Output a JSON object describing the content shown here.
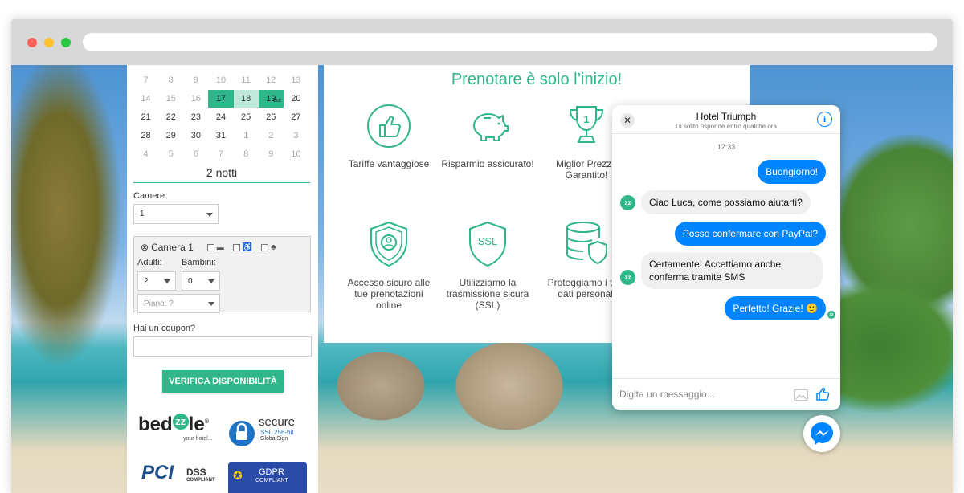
{
  "calendar": {
    "rows": [
      [
        {
          "d": "7",
          "s": "dim"
        },
        {
          "d": "8",
          "s": "dim"
        },
        {
          "d": "9",
          "s": "dim"
        },
        {
          "d": "10",
          "s": "dim"
        },
        {
          "d": "11",
          "s": "dim"
        },
        {
          "d": "12",
          "s": "dim"
        },
        {
          "d": "13",
          "s": "dim"
        }
      ],
      [
        {
          "d": "14",
          "s": "dim"
        },
        {
          "d": "15",
          "s": "dim"
        },
        {
          "d": "16",
          "s": "dim"
        },
        {
          "d": "17",
          "s": "sel"
        },
        {
          "d": "18",
          "s": "mid"
        },
        {
          "d": "19",
          "s": "out"
        },
        {
          "d": "20",
          "s": ""
        }
      ],
      [
        {
          "d": "21",
          "s": ""
        },
        {
          "d": "22",
          "s": ""
        },
        {
          "d": "23",
          "s": ""
        },
        {
          "d": "24",
          "s": ""
        },
        {
          "d": "25",
          "s": ""
        },
        {
          "d": "26",
          "s": ""
        },
        {
          "d": "27",
          "s": ""
        }
      ],
      [
        {
          "d": "28",
          "s": ""
        },
        {
          "d": "29",
          "s": ""
        },
        {
          "d": "30",
          "s": ""
        },
        {
          "d": "31",
          "s": ""
        },
        {
          "d": "1",
          "s": "dim"
        },
        {
          "d": "2",
          "s": "dim"
        },
        {
          "d": "3",
          "s": "dim"
        }
      ],
      [
        {
          "d": "4",
          "s": "dim"
        },
        {
          "d": "5",
          "s": "dim"
        },
        {
          "d": "6",
          "s": "dim"
        },
        {
          "d": "7",
          "s": "dim"
        },
        {
          "d": "8",
          "s": "dim"
        },
        {
          "d": "9",
          "s": "dim"
        },
        {
          "d": "10",
          "s": "dim"
        }
      ]
    ],
    "out_label": "out"
  },
  "booking": {
    "nights": "2 notti",
    "rooms_label": "Camere:",
    "rooms_value": "1",
    "room_title": "Camera 1",
    "adults_label": "Adulti:",
    "adults_value": "2",
    "children_label": "Bambini:",
    "children_value": "0",
    "floor_placeholder": "Piano: ?",
    "coupon_label": "Hai un coupon?",
    "verify_button": "VERIFICA DISPONIBILITÀ"
  },
  "logos": {
    "bedzzle_pre": "bed",
    "bedzzle_z": "zz",
    "bedzzle_post": "le",
    "bedzzle_reg": "®",
    "bedzzle_sub": "your hotel...",
    "secure_title": "secure",
    "secure_sub": "SSL 256-bit",
    "secure_brand": "GlobalSign",
    "pci": "PCI",
    "dss": "DSS",
    "dss_sub": "COMPLIANT",
    "gdpr": "GDPR",
    "gdpr_sub": "COMPLIANT"
  },
  "panel": {
    "title": "Prenotare è solo l’inizio!",
    "features": [
      {
        "icon": "thumbs-up-icon",
        "label": "Tariffe vantaggiose"
      },
      {
        "icon": "piggy-bank-icon",
        "label": "Risparmio assicurato!"
      },
      {
        "icon": "trophy-icon",
        "label": "Miglior Prezzo Garantito!"
      },
      {
        "icon": "shield-user-icon",
        "label": "Accesso sicuro alle tue prenotazioni online"
      },
      {
        "icon": "ssl-shield-icon",
        "label": "Utilizziamo la trasmissione sicura (SSL)"
      },
      {
        "icon": "database-shield-icon",
        "label": "Proteggiamo i tuoi dati personali"
      }
    ],
    "trophy_number": "1",
    "ssl_text": "SSL"
  },
  "chat": {
    "hotel_name": "Hotel Triumph",
    "subtitle": "Di solito risponde entro qualche ora",
    "time": "12:33",
    "messages": [
      {
        "from": "me",
        "text": "Buongiorno!"
      },
      {
        "from": "them",
        "text": "Ciao Luca, come possiamo aiutarti?"
      },
      {
        "from": "me",
        "text": "Posso confermare con PayPal?"
      },
      {
        "from": "them",
        "text": "Certamente! Accettiamo anche conferma tramite SMS"
      },
      {
        "from": "me",
        "text": "Perfetto! Grazie! 🙂"
      }
    ],
    "avatar_text": "zz",
    "input_placeholder": "Digita un messaggio...",
    "close_symbol": "✕",
    "info_symbol": "i"
  },
  "colors": {
    "accent": "#2fb68a",
    "messenger_blue": "#0084ff"
  }
}
